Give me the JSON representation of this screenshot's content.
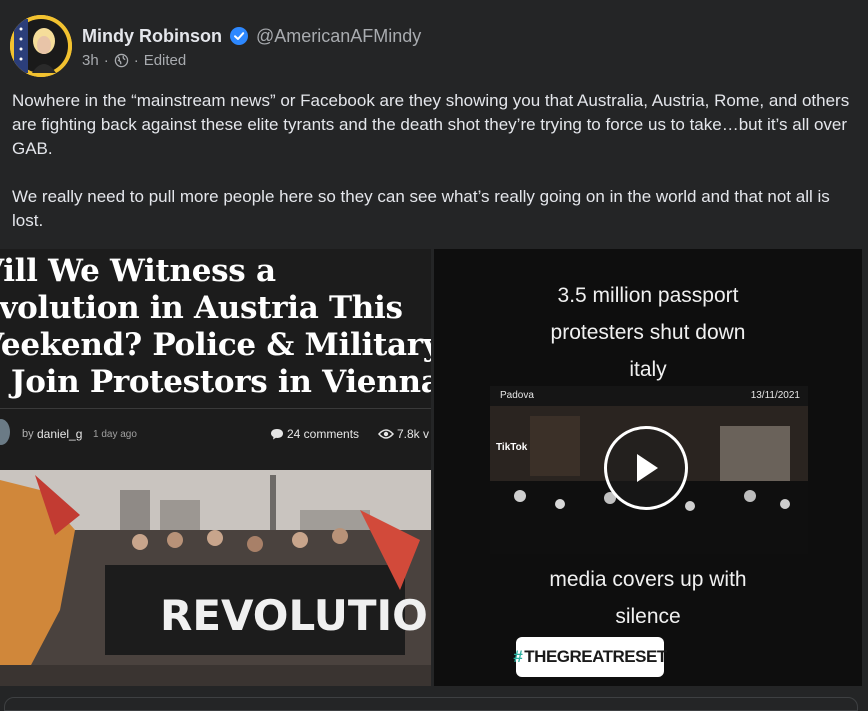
{
  "author": {
    "name": "Mindy Robinson",
    "handle": "@AmericanAFMindy",
    "verified": true
  },
  "meta": {
    "time": "3h",
    "separator": "·",
    "visibility_icon": "globe-icon",
    "edited": "Edited"
  },
  "post": {
    "paragraph_1": "Nowhere in the “mainstream news” or Facebook are they showing you that Australia, Austria, Rome, and others are fighting back against these elite tyrants and the death shot they’re trying to force us to take…but it’s all over GAB.",
    "paragraph_2": "We really need to pull more people here so they can see what’s really going on in the world and that not all is lost."
  },
  "article": {
    "title_lines": [
      "Vill We Witness a",
      "evolution in Austria This",
      "Veekend? Police & Military",
      "o Join Protestors in Vienna"
    ],
    "byline_by": "by",
    "byline_author": "daniel_g",
    "byline_date": "1 day ago",
    "comments": "24 comments",
    "views": "7.8k v",
    "banner_text": "REVOLUTION"
  },
  "video": {
    "caption_top_lines": [
      "3.5 million passport",
      "protesters shut down",
      "italy"
    ],
    "frame_location": "Padova",
    "frame_date": "13/11/2021",
    "watermark": "TikTok",
    "caption_bottom_lines": [
      "media covers up with",
      "silence"
    ],
    "hashtag_symbol": "#",
    "hashtag_text": "THEGREATRESET"
  },
  "colors": {
    "background": "#242526",
    "verified_blue": "#2d88ff",
    "text_primary": "#e4e6eb",
    "text_secondary": "#a8abaf",
    "hashtag_teal": "#2ab0a0"
  }
}
